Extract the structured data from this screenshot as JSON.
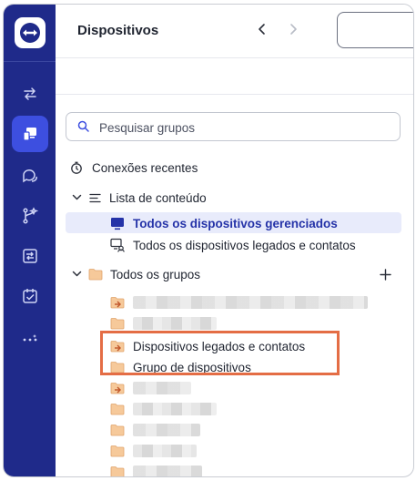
{
  "colors": {
    "rail_bg": "#1f2a8a",
    "rail_active": "#3d4fe0",
    "accent_text": "#2533a8",
    "selection_bg": "#e8ebfb",
    "folder": "#f0b27a",
    "highlight_border": "#e46d45"
  },
  "rail": {
    "logo_icon": "teamviewer-logo-icon",
    "items": [
      {
        "icon": "transfer-arrows-icon",
        "active": false
      },
      {
        "icon": "devices-icon",
        "active": true
      },
      {
        "icon": "chat-icon",
        "active": false
      },
      {
        "icon": "workflow-icon",
        "active": false
      },
      {
        "icon": "session-icon",
        "active": false
      },
      {
        "icon": "tasks-icon",
        "active": false
      },
      {
        "icon": "more-icon",
        "active": false
      }
    ]
  },
  "header": {
    "title": "Dispositivos",
    "back_icon": "chevron-left-icon",
    "forward_icon": "chevron-right-icon"
  },
  "search": {
    "placeholder": "Pesquisar grupos",
    "value": ""
  },
  "tree": {
    "recent": "Conexões recentes",
    "content_list": "Lista de conteúdo",
    "managed_devices": "Todos os dispositivos gerenciados",
    "legacy_devices": "Todos os dispositivos legados e contatos",
    "all_groups": "Todos os grupos",
    "add_icon": "plus-icon",
    "groups": [
      {
        "label": "",
        "icon": "shared-folder-icon",
        "redacted": true
      },
      {
        "label": "",
        "icon": "folder-icon",
        "redacted": true
      },
      {
        "label": "Dispositivos legados e contatos",
        "icon": "shared-folder-icon",
        "redacted": false
      },
      {
        "label": "Grupo de dispositivos",
        "icon": "folder-icon",
        "redacted": false
      },
      {
        "label": "",
        "icon": "shared-folder-icon",
        "redacted": true
      },
      {
        "label": "",
        "icon": "folder-icon",
        "redacted": true
      },
      {
        "label": "",
        "icon": "folder-icon",
        "redacted": true
      },
      {
        "label": "",
        "icon": "folder-icon",
        "redacted": true
      },
      {
        "label": "",
        "icon": "folder-icon",
        "redacted": true
      }
    ]
  }
}
